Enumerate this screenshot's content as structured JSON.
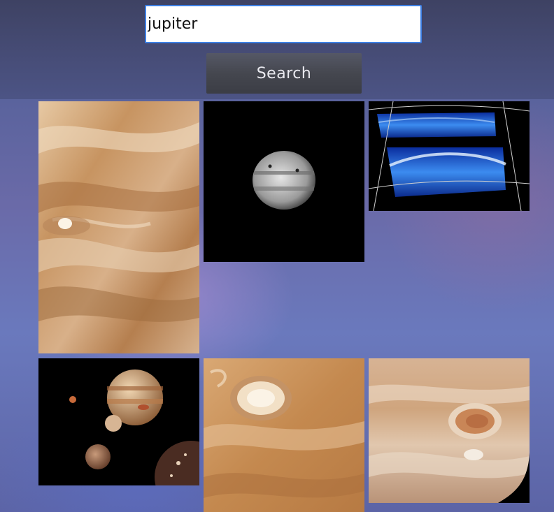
{
  "search": {
    "value": "jupiter",
    "placeholder": ""
  },
  "search_button": {
    "label": "Search"
  },
  "results": [
    {
      "subject": "jupiter-cloud-bands-closeup"
    },
    {
      "subject": "jupiter-telescope-grayscale"
    },
    {
      "subject": "jupiter-ultraviolet-aurora"
    },
    {
      "subject": "jupiter-with-galilean-moons"
    },
    {
      "subject": "jupiter-white-oval-storm"
    },
    {
      "subject": "jupiter-great-red-spot"
    }
  ],
  "colors": {
    "input_border": "#3d7fe3",
    "button_bg": "#45474f",
    "button_text": "#e9e9ef"
  }
}
